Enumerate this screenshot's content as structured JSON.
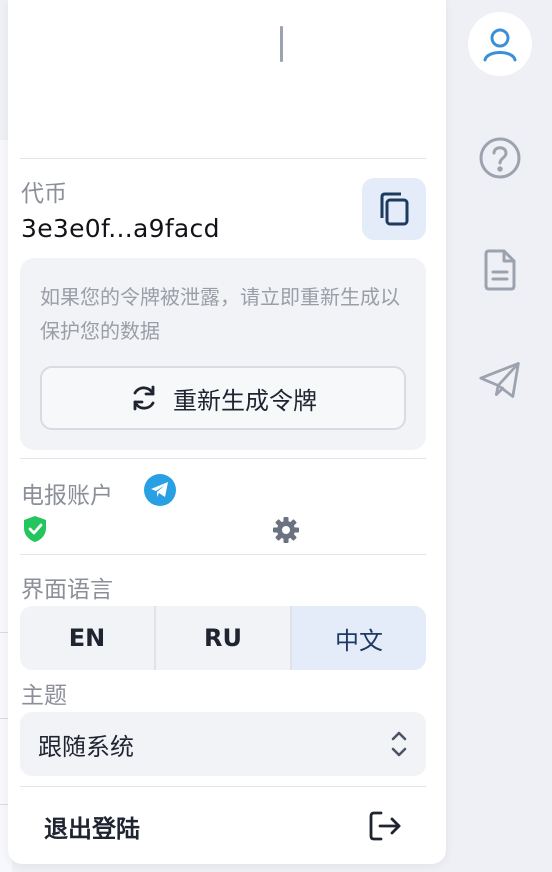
{
  "token": {
    "label": "代币",
    "value": "3e3e0f...a9facd"
  },
  "warning": {
    "text": "如果您的令牌被泄露，请立即重新生成以保护您的数据",
    "regenerate_label": "重新生成令牌"
  },
  "telegram": {
    "label": "电报账户"
  },
  "language": {
    "label": "界面语言",
    "options": [
      "EN",
      "RU",
      "中文"
    ],
    "selected": "中文"
  },
  "theme": {
    "label": "主题",
    "value": "跟随系统"
  },
  "logout": {
    "label": "退出登陆"
  },
  "colors": {
    "accent": "#2aa0e4",
    "active_bg": "#e3ecf8",
    "verified": "#22c55e",
    "rail_icon": "#9ca3af",
    "user_icon": "#3b8fd9"
  }
}
